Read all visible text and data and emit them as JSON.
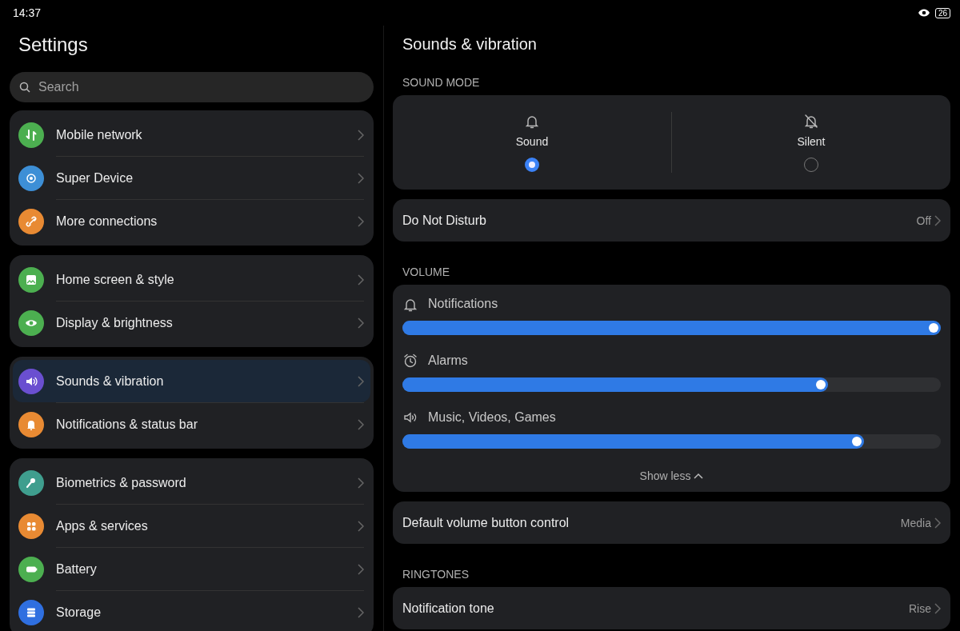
{
  "status_bar": {
    "time": "14:37",
    "battery": "26"
  },
  "sidebar": {
    "title": "Settings",
    "search": {
      "placeholder": "Search"
    },
    "groups": [
      {
        "items": [
          {
            "label": "Mobile network",
            "color": "#4caf50",
            "selected": false
          },
          {
            "label": "Super Device",
            "color": "#3d8fd6",
            "selected": false
          },
          {
            "label": "More connections",
            "color": "#e88a33",
            "selected": false
          }
        ]
      },
      {
        "items": [
          {
            "label": "Home screen & style",
            "color": "#4caf50",
            "selected": false
          },
          {
            "label": "Display & brightness",
            "color": "#4caf50",
            "selected": false
          }
        ]
      },
      {
        "items": [
          {
            "label": "Sounds & vibration",
            "color": "#6a4fd0",
            "selected": true
          },
          {
            "label": "Notifications & status bar",
            "color": "#e88a33",
            "selected": false
          }
        ]
      },
      {
        "items": [
          {
            "label": "Biometrics & password",
            "color": "#3f9e8e",
            "selected": false
          },
          {
            "label": "Apps & services",
            "color": "#e88a33",
            "selected": false
          },
          {
            "label": "Battery",
            "color": "#4caf50",
            "selected": false
          },
          {
            "label": "Storage",
            "color": "#2f6fe0",
            "selected": false
          }
        ]
      }
    ]
  },
  "content": {
    "title": "Sounds & vibration",
    "sound_mode": {
      "heading": "SOUND MODE",
      "options": [
        {
          "label": "Sound",
          "selected": true
        },
        {
          "label": "Silent",
          "selected": false
        }
      ]
    },
    "do_not_disturb": {
      "label": "Do Not Disturb",
      "value": "Off"
    },
    "volume": {
      "heading": "VOLUME",
      "sliders": [
        {
          "label": "Notifications",
          "level": 1.0
        },
        {
          "label": "Alarms",
          "level": 0.79
        },
        {
          "label": "Music, Videos, Games",
          "level": 0.857
        }
      ],
      "toggle": "Show less"
    },
    "default_volume": {
      "label": "Default volume button control",
      "value": "Media"
    },
    "ringtones": {
      "heading": "RINGTONES",
      "items": [
        {
          "label": "Notification tone",
          "value": "Rise"
        }
      ]
    }
  }
}
